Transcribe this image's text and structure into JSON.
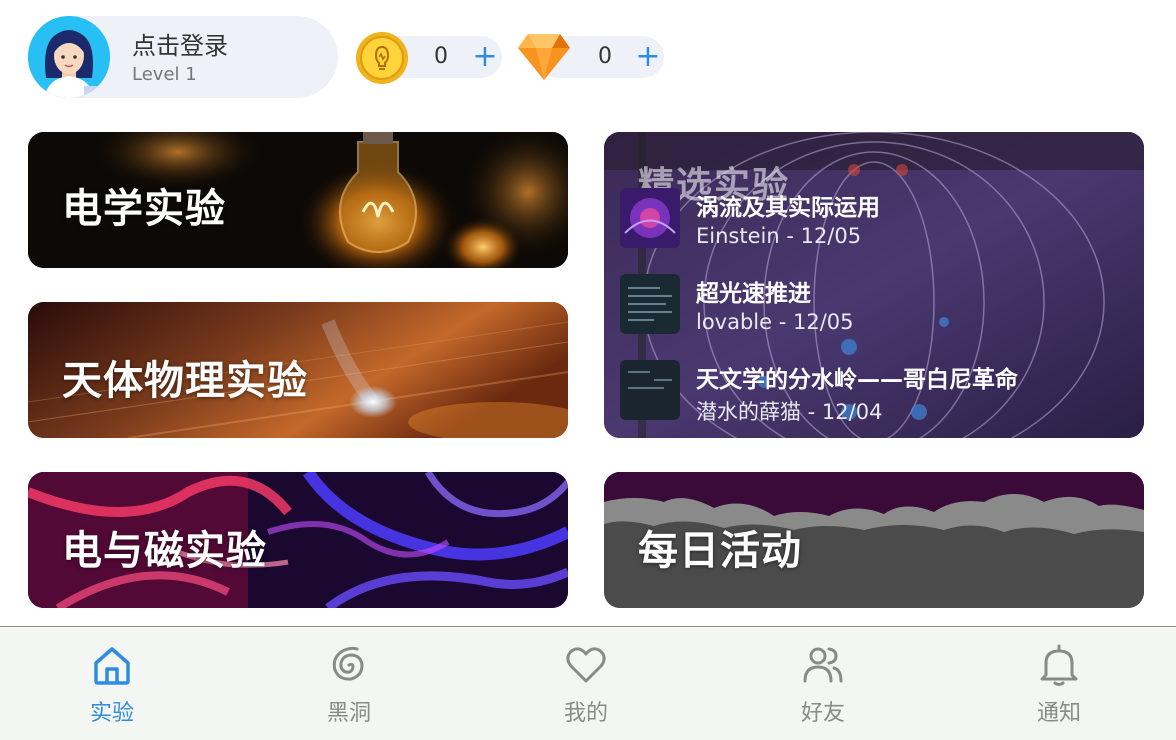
{
  "header": {
    "username": "点击登录",
    "level": "Level 1",
    "coins": {
      "value": "0",
      "add": "+"
    },
    "gems": {
      "value": "0",
      "add": "+"
    }
  },
  "cards": {
    "electricity": {
      "title": "电学实验"
    },
    "astrophysics": {
      "title": "天体物理实验"
    },
    "electromagnetism": {
      "title": "电与磁实验"
    },
    "daily": {
      "title": "每日活动"
    }
  },
  "featured": {
    "title": "精选实验",
    "items": [
      {
        "title": "涡流及其实际运用",
        "meta": "Einstein - 12/05"
      },
      {
        "title": "超光速推进",
        "meta": "lovable - 12/05"
      },
      {
        "title": "天文学的分水岭——哥白尼革命",
        "meta": "潜水的薛猫 - 12/04"
      }
    ]
  },
  "nav": {
    "items": [
      {
        "label": "实验",
        "icon": "home-icon",
        "active": true
      },
      {
        "label": "黑洞",
        "icon": "spiral-icon"
      },
      {
        "label": "我的",
        "icon": "heart-icon"
      },
      {
        "label": "好友",
        "icon": "users-icon"
      },
      {
        "label": "通知",
        "icon": "bell-icon"
      }
    ]
  },
  "colors": {
    "accent": "#2c8de0",
    "pill_bg": "#eef1f8",
    "nav_bg": "#f3f6f3",
    "inactive": "#8a8a8a"
  }
}
